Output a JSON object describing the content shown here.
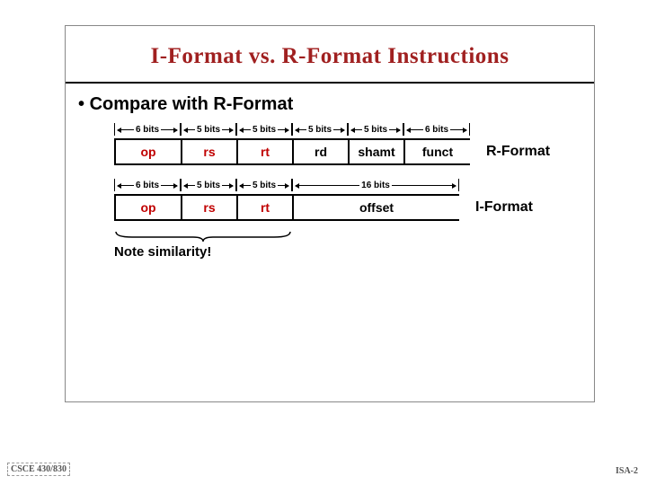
{
  "title": "I-Format vs. R-Format Instructions",
  "bullet": "Compare with R-Format",
  "rformat": {
    "bits": [
      "6 bits",
      "5 bits",
      "5 bits",
      "5 bits",
      "5 bits",
      "6 bits"
    ],
    "fields": [
      "op",
      "rs",
      "rt",
      "rd",
      "shamt",
      "funct"
    ],
    "label": "R-Format"
  },
  "iformat": {
    "bits": [
      "6 bits",
      "5 bits",
      "5 bits",
      "16 bits"
    ],
    "fields": [
      "op",
      "rs",
      "rt",
      "offset"
    ],
    "label": "I-Format"
  },
  "note": "Note similarity!",
  "footer_left": "CSCE 430/830",
  "footer_right": "ISA-2",
  "widths": {
    "w6": 74,
    "w5": 62,
    "w16": 186
  }
}
